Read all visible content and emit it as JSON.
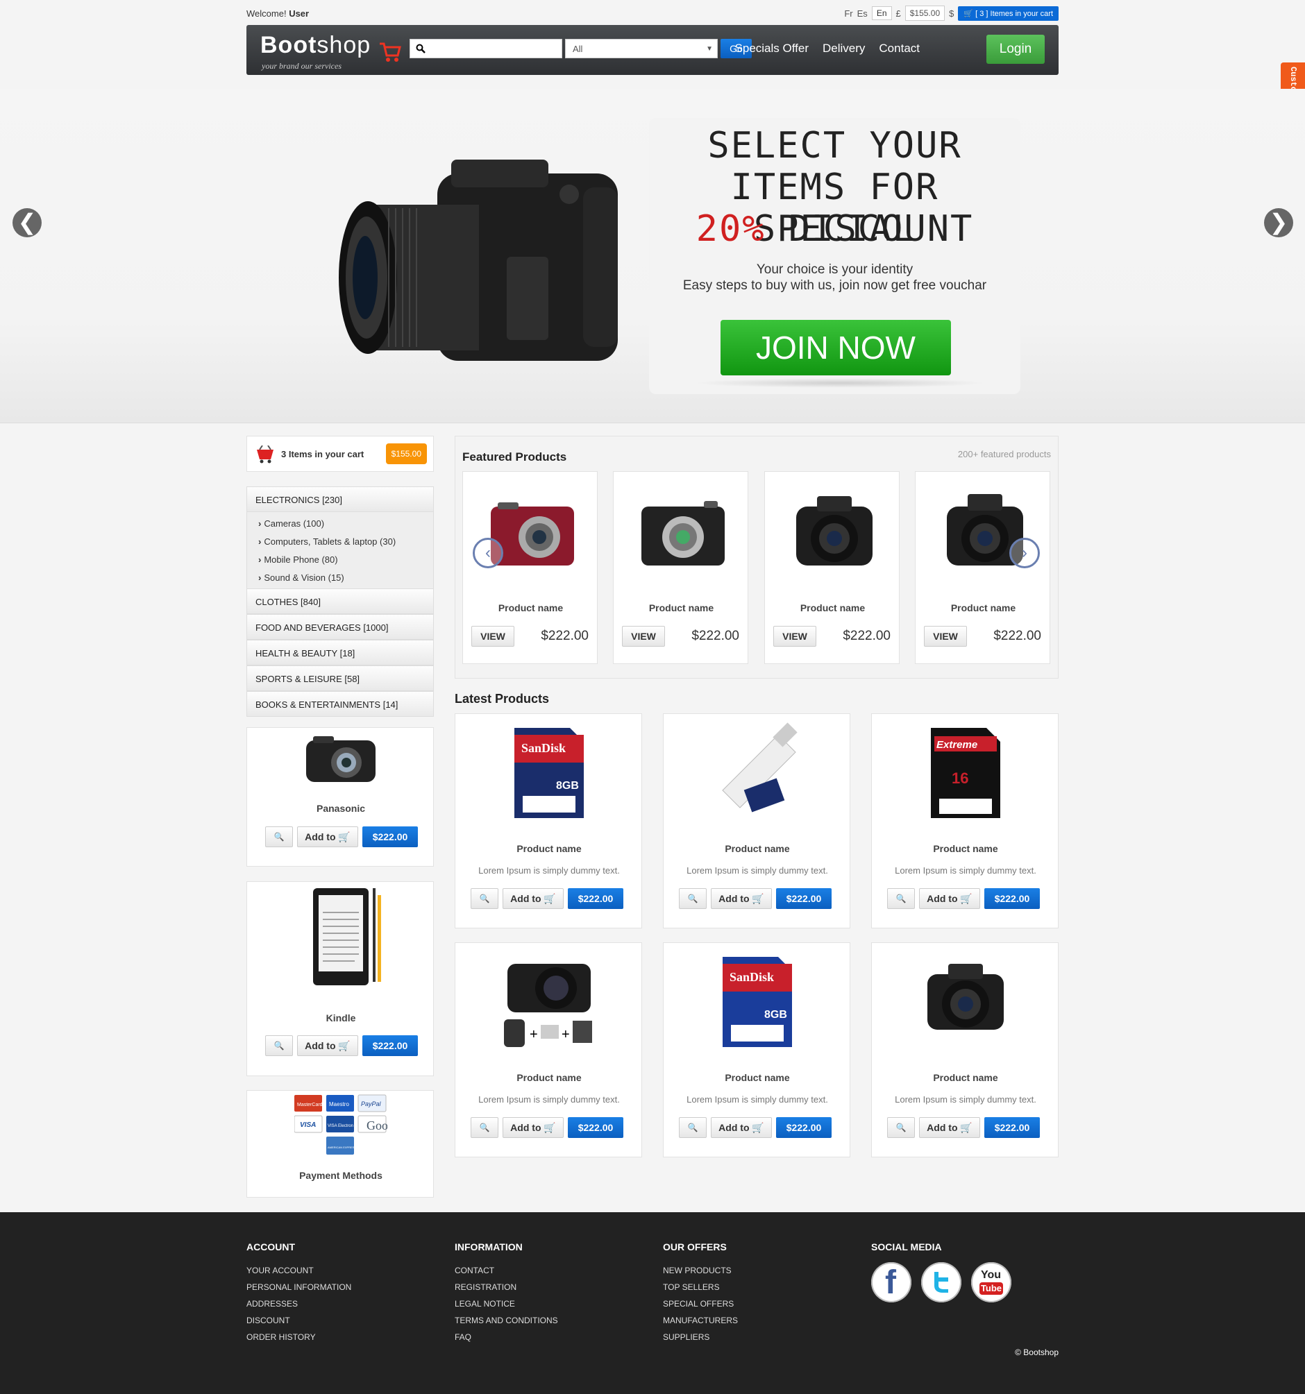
{
  "topbar": {
    "welcome_prefix": "Welcome!",
    "welcome_user": "User",
    "lang_fr": "Fr",
    "lang_es": "Es",
    "lang_en": "En",
    "currency_pound": "£",
    "amount": "$155.00",
    "currency_dollar": "$",
    "cart_label": "[ 3 ] Itemes in your cart"
  },
  "navbar": {
    "brand_bold": "Boot",
    "brand_rest": "shop",
    "tagline": "your brand our services",
    "search_placeholder": "",
    "category_select": "All",
    "go_label": "Go",
    "links": [
      "Specials Offer",
      "Delivery",
      "Contact"
    ],
    "login_label": "Login"
  },
  "customize_label": "Customize",
  "hero": {
    "line1": "SELECT YOUR",
    "line2": "ITEMS FOR SPECIAL",
    "line3_red": "20%",
    "line3_rest": " DISCOUNT",
    "sub1": "Your choice is your identity",
    "sub2": "Easy steps to buy with us, join now get free vouchar",
    "join_label": "JOIN NOW",
    "prev_arrow": "❮",
    "next_arrow": "❯"
  },
  "sidebar": {
    "cart_text": "3 Items in your cart",
    "cart_amount": "$155.00",
    "categories": [
      {
        "label": "ELECTRONICS [230]"
      },
      {
        "label": "CLOTHES [840]"
      },
      {
        "label": "FOOD AND BEVERAGES [1000]"
      },
      {
        "label": "HEALTH & BEAUTY [18]"
      },
      {
        "label": "SPORTS & LEISURE [58]"
      },
      {
        "label": "BOOKS & ENTERTAINMENTS [14]"
      }
    ],
    "subcategories": [
      "Cameras (100)",
      "Computers, Tablets & laptop (30)",
      "Mobile Phone (80)",
      "Sound & Vision (15)"
    ],
    "cards": [
      {
        "name": "Panasonic",
        "add": "Add to",
        "price": "$222.00"
      },
      {
        "name": "Kindle",
        "add": "Add to",
        "price": "$222.00"
      }
    ],
    "payment_label": "Payment Methods",
    "payment_logos": [
      "MasterCard",
      "Maestro",
      "PayPal",
      "VISA",
      "VISA Electron",
      "Google",
      "AMERICAN EXPRESS"
    ]
  },
  "featured": {
    "title": "Featured Products",
    "count": "200+ featured products",
    "items": [
      {
        "name": "Product name",
        "view": "VIEW",
        "price": "$222.00"
      },
      {
        "name": "Product name",
        "view": "VIEW",
        "price": "$222.00"
      },
      {
        "name": "Product name",
        "view": "VIEW",
        "price": "$222.00"
      },
      {
        "name": "Product name",
        "view": "VIEW",
        "price": "$222.00"
      }
    ]
  },
  "latest": {
    "title": "Latest Products",
    "items": [
      {
        "name": "Product name",
        "desc": "Lorem Ipsum is simply dummy text.",
        "add": "Add to",
        "price": "$222.00"
      },
      {
        "name": "Product name",
        "desc": "Lorem Ipsum is simply dummy text.",
        "add": "Add to",
        "price": "$222.00"
      },
      {
        "name": "Product name",
        "desc": "Lorem Ipsum is simply dummy text.",
        "add": "Add to",
        "price": "$222.00"
      },
      {
        "name": "Product name",
        "desc": "Lorem Ipsum is simply dummy text.",
        "add": "Add to",
        "price": "$222.00"
      },
      {
        "name": "Product name",
        "desc": "Lorem Ipsum is simply dummy text.",
        "add": "Add to",
        "price": "$222.00"
      },
      {
        "name": "Product name",
        "desc": "Lorem Ipsum is simply dummy text.",
        "add": "Add to",
        "price": "$222.00"
      }
    ]
  },
  "footer": {
    "account": {
      "title": "ACCOUNT",
      "links": [
        "YOUR ACCOUNT",
        "PERSONAL INFORMATION",
        "ADDRESSES",
        "DISCOUNT",
        "ORDER HISTORY"
      ]
    },
    "information": {
      "title": "INFORMATION",
      "links": [
        "CONTACT",
        "REGISTRATION",
        "LEGAL NOTICE",
        "TERMS AND CONDITIONS",
        "FAQ"
      ]
    },
    "offers": {
      "title": "OUR OFFERS",
      "links": [
        "NEW PRODUCTS",
        "TOP SELLERS",
        "SPECIAL OFFERS",
        "MANUFACTURERS",
        "SUPPLIERS"
      ]
    },
    "social": {
      "title": "SOCIAL MEDIA",
      "icons": [
        "facebook-icon",
        "twitter-icon",
        "youtube-icon"
      ],
      "facebook_glyph": "f",
      "youtube_top": "You",
      "youtube_bottom": "Tube"
    },
    "copyright": "© Bootshop"
  },
  "colors": {
    "accent_blue": "#0b6ad6",
    "login_green": "#4cae4c",
    "join_green": "#22aa22",
    "badge_orange": "#f89406",
    "customize_orange": "#f05a1a",
    "discount_red": "#d02020"
  }
}
